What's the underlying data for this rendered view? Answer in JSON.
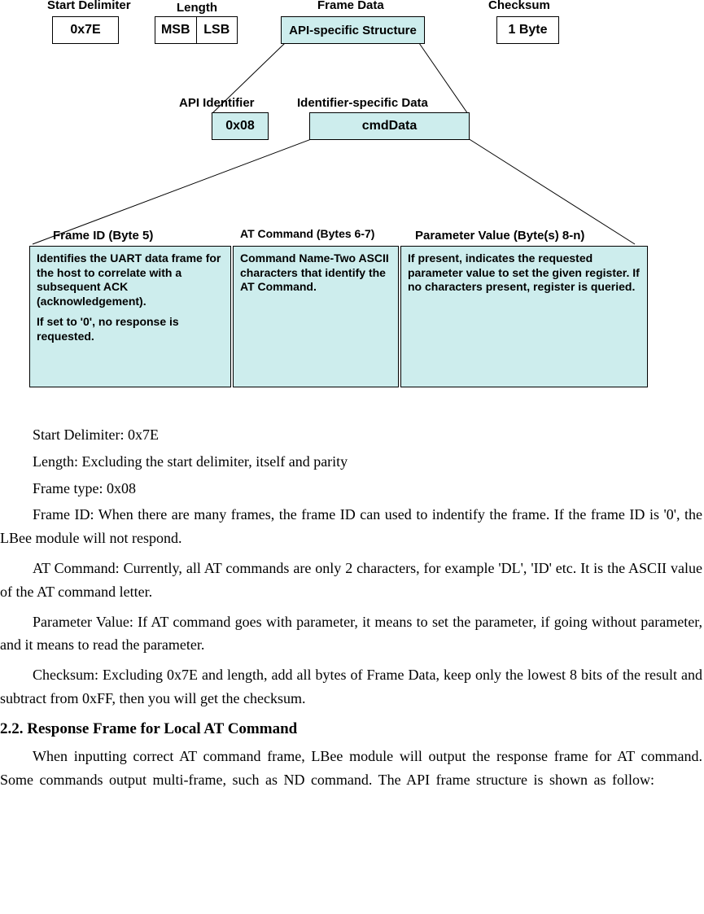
{
  "diagram": {
    "row1": {
      "startDelimiter": {
        "label": "Start Delimiter",
        "box": "0x7E"
      },
      "length": {
        "label": "Length",
        "msb": "MSB",
        "lsb": "LSB"
      },
      "frameData": {
        "label": "Frame Data",
        "box": "API-specific Structure"
      },
      "checksum": {
        "label": "Checksum",
        "box": "1 Byte"
      }
    },
    "row2": {
      "apiId": {
        "label": "API Identifier",
        "box": "0x08"
      },
      "idData": {
        "label": "Identifier-specific Data",
        "box": "cmdData"
      }
    },
    "row3": {
      "frameId": {
        "label": "Frame ID (Byte 5)",
        "line1": "Identifies the UART data frame for the host to correlate with a subsequent ACK (acknowledgement).",
        "line2": "If set to '0', no response is requested."
      },
      "atCmd": {
        "label": "AT Command (Bytes 6-7)",
        "line1": "Command Name-Two ASCII characters that identify the AT Command."
      },
      "paramVal": {
        "label": "Parameter Value (Byte(s) 8-n)",
        "line1": "If present, indicates the requested parameter value to set the given register. If no characters present, register is queried."
      }
    }
  },
  "defs": {
    "startDelim": "Start Delimiter: 0x7E",
    "length": "Length: Excluding the start delimiter, itself and parity",
    "frameType": "Frame type: 0x08",
    "frameId": "Frame ID: When there are many frames, the frame ID can used to indentify the frame. If the frame ID is '0', the LBee module will not respond.",
    "atCmd": "AT Command: Currently, all AT commands are only 2 characters, for example 'DL', 'ID' etc. It is the ASCII value of the AT command letter.",
    "paramVal": "Parameter Value: If AT command goes with parameter, it means to set the parameter, if going without parameter, and it means to read the parameter.",
    "checksum": "Checksum: Excluding 0x7E and length, add all bytes of Frame Data, keep only the lowest 8 bits of the result and subtract from 0xFF, then you will get the checksum."
  },
  "section": {
    "heading": "2.2. Response Frame for Local AT Command",
    "para": "When inputting correct AT command frame, LBee module will output the response frame for AT command. Some commands output multi-frame, such as ND command. The API frame structure is shown as follow:"
  }
}
